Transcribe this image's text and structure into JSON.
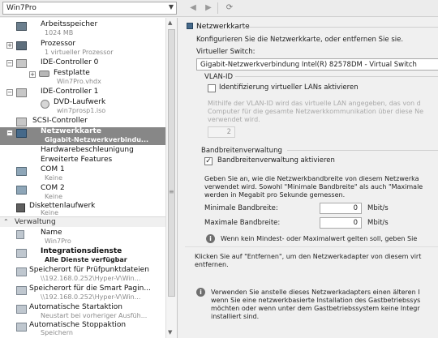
{
  "toolbar": {
    "vm_name": "Win7Pro",
    "back_glyph": "◀",
    "forward_glyph": "▶",
    "refresh_glyph": "⟳"
  },
  "tree": {
    "items": [
      {
        "label": "Arbeitsspeicher",
        "sub": "1024 MB",
        "icon": "ram-icon"
      },
      {
        "label": "Prozessor",
        "sub": "1 virtueller Prozessor",
        "icon": "cpu-icon",
        "expander": "+"
      },
      {
        "label": "IDE-Controller 0",
        "sub": "",
        "icon": "ide-icon",
        "expander": "−"
      },
      {
        "label": "Festplatte",
        "sub": "Win7Pro.vhdx",
        "icon": "disk-icon",
        "expander": "+"
      },
      {
        "label": "IDE-Controller 1",
        "sub": "",
        "icon": "ide-icon",
        "expander": "−"
      },
      {
        "label": "DVD-Laufwerk",
        "sub": "win7prosp1.iso",
        "icon": "dvd-icon"
      },
      {
        "label": "SCSI-Controller",
        "sub": "",
        "icon": "scsi-icon"
      },
      {
        "label": "Netzwerkkarte",
        "sub": "Gigabit-Netzwerkverbindu...",
        "icon": "network-adapter-icon",
        "expander": "−",
        "selected": true
      },
      {
        "label": "Hardwarebeschleunigung",
        "sub": "",
        "icon": ""
      },
      {
        "label": "Erweiterte Features",
        "sub": "",
        "icon": ""
      },
      {
        "label": "COM 1",
        "sub": "Keine",
        "icon": "com-port-icon"
      },
      {
        "label": "COM 2",
        "sub": "Keine",
        "icon": "com-port-icon"
      },
      {
        "label": "Diskettenlaufwerk",
        "sub": "Keine",
        "icon": "floppy-icon"
      }
    ],
    "management_header": "Verwaltung",
    "management_items": [
      {
        "label": "Name",
        "sub": "Win7Pro",
        "icon": "name-icon"
      },
      {
        "label": "Integrationsdienste",
        "sub": "Alle Dienste verfügbar",
        "icon": "integration-icon",
        "bold": true
      },
      {
        "label": "Speicherort für Prüfpunktdateien",
        "sub": "\\\\192.168.0.252\\Hyper-V\\Win...",
        "icon": "checkpoint-icon"
      },
      {
        "label": "Speicherort für die Smart Pagin...",
        "sub": "\\\\192.168.0.252\\Hyper-V\\Win...",
        "icon": "smart-paging-icon"
      },
      {
        "label": "Automatische Startaktion",
        "sub": "Neustart bei vorheriger Ausfüh...",
        "icon": "autostart-icon"
      },
      {
        "label": "Automatische Stoppaktion",
        "sub": "Speichern",
        "icon": "autostop-icon"
      }
    ]
  },
  "panel": {
    "title": "Netzwerkkarte",
    "description": "Konfigurieren Sie die Netzwerkkarte, oder entfernen Sie sie.",
    "switch_label": "Virtueller Switch:",
    "switch_value": "Gigabit-Netzwerkverbindung Intel(R) 82578DM - Virtual Switch",
    "vlan_heading": "VLAN-ID",
    "vlan_checkbox_label": "Identifizierung virtueller LANs aktivieren",
    "vlan_help_1": "Mithilfe der VLAN-ID wird das virtuelle LAN angegeben, das von d",
    "vlan_help_2": "Computer für die gesamte Netzwerkkommunikation über diese Ne",
    "vlan_help_3": "verwendet wird.",
    "vlan_id_value": "2",
    "bw_heading": "Bandbreitenverwaltung",
    "bw_checkbox_label": "Bandbreitenverwaltung aktivieren",
    "bw_help_1": "Geben Sie an, wie die Netzwerkbandbreite von diesem Netzwerka",
    "bw_help_2": "verwendet wird. Sowohl \"Minimale Bandbreite\" als auch \"Maximale",
    "bw_help_3": "werden in Megabit pro Sekunde gemessen.",
    "min_bw_label": "Minimale Bandbreite:",
    "min_bw_value": "0",
    "max_bw_label": "Maximale Bandbreite:",
    "max_bw_value": "0",
    "unit": "Mbit/s",
    "bw_info": "Wenn kein Mindest- oder Maximalwert gelten soll, geben Sie",
    "remove_help_1": "Klicken Sie auf \"Entfernen\", um den Netzwerkadapter von diesem virt",
    "remove_help_2": "entfernen.",
    "legacy_1": "Verwenden Sie anstelle dieses Netzwerkadapters einen älteren I",
    "legacy_2": "wenn Sie eine netzwerkbasierte Installation des Gastbetriebssys",
    "legacy_3": "möchten oder wenn unter dem Gastbetriebssystem keine Integr",
    "legacy_4": "installiert sind."
  }
}
